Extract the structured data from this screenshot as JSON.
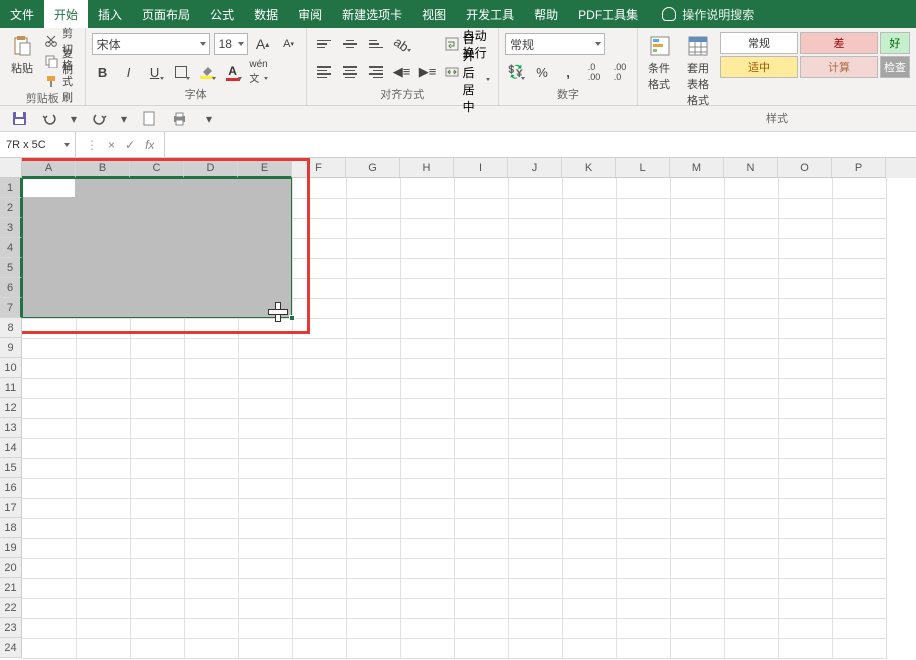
{
  "menubar": {
    "items": [
      "文件",
      "开始",
      "插入",
      "页面布局",
      "公式",
      "数据",
      "审阅",
      "新建选项卡",
      "视图",
      "开发工具",
      "帮助",
      "PDF工具集"
    ],
    "active_index": 1,
    "search_text": "操作说明搜索"
  },
  "ribbon": {
    "clipboard": {
      "paste": "粘贴",
      "cut": "剪切",
      "copy": "复制",
      "format_painter": "格式刷",
      "group_label": "剪贴板"
    },
    "font": {
      "name": "宋体",
      "size": "18",
      "increase_label": "A",
      "decrease_label": "A",
      "bold": "B",
      "italic": "I",
      "underline": "U",
      "group_label": "字体"
    },
    "alignment": {
      "wrap_text": "自动换行",
      "merge_center": "合并后居中",
      "group_label": "对齐方式"
    },
    "number": {
      "format": "常规",
      "percent": "%",
      "comma": ",",
      "group_label": "数字"
    },
    "styles": {
      "conditional": "条件格式",
      "table": "套用\n表格格式",
      "cells": [
        {
          "label": "常规",
          "bg": "#ffffff",
          "fg": "#333"
        },
        {
          "label": "差",
          "bg": "#f4c7c3",
          "fg": "#9c0006"
        },
        {
          "label": "好",
          "bg": "#c6efce",
          "fg": "#006100"
        },
        {
          "label": "适中",
          "bg": "#ffeb9c",
          "fg": "#9c5700"
        },
        {
          "label": "计算",
          "bg": "#f2d7d5",
          "fg": "#b26b3e"
        },
        {
          "label": "检查",
          "bg": "#a5a5a5",
          "fg": "#ffffff"
        }
      ],
      "group_label": "样式"
    }
  },
  "formula_bar": {
    "name_box": "7R x 5C",
    "cancel": "×",
    "enter": "✓",
    "fx": "fx",
    "value": ""
  },
  "grid": {
    "columns": [
      "A",
      "B",
      "C",
      "D",
      "E",
      "F",
      "G",
      "H",
      "I",
      "J",
      "K",
      "L",
      "M",
      "N",
      "O",
      "P"
    ],
    "rows": 24,
    "selected_cols": [
      0,
      1,
      2,
      3,
      4
    ],
    "selected_rows": [
      0,
      1,
      2,
      3,
      4,
      5,
      6
    ],
    "selection": {
      "top": 0,
      "left": 0,
      "rows": 7,
      "cols": 5
    },
    "active_cell": {
      "row": 0,
      "col": 0
    }
  }
}
